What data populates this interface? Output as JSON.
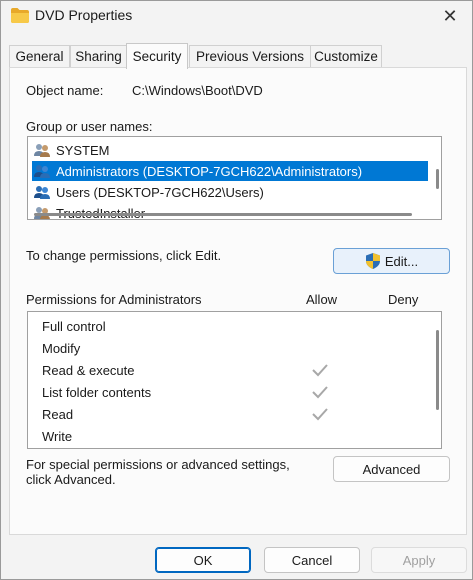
{
  "window": {
    "title": "DVD Properties",
    "close_glyph": "✕",
    "folder_color": "#f5c242"
  },
  "tabs": [
    {
      "label": "General",
      "active": false
    },
    {
      "label": "Sharing",
      "active": false
    },
    {
      "label": "Security",
      "active": true
    },
    {
      "label": "Previous Versions",
      "active": false
    },
    {
      "label": "Customize",
      "active": false
    }
  ],
  "security": {
    "object_name_label": "Object name:",
    "object_name_value": "C:\\Windows\\Boot\\DVD",
    "group_label": "Group or user names:",
    "users": [
      {
        "name": "SYSTEM",
        "selected": false
      },
      {
        "name": "Administrators (DESKTOP-7GCH622\\Administrators)",
        "selected": true
      },
      {
        "name": "Users (DESKTOP-7GCH622\\Users)",
        "selected": false
      },
      {
        "name": "TrustedInstaller",
        "selected": false
      }
    ],
    "change_hint": "To change permissions, click Edit.",
    "edit_button": "Edit...",
    "permissions_label": "Permissions for Administrators",
    "allow_header": "Allow",
    "deny_header": "Deny",
    "permissions": [
      {
        "name": "Full control",
        "allow": false,
        "deny": false
      },
      {
        "name": "Modify",
        "allow": false,
        "deny": false
      },
      {
        "name": "Read & execute",
        "allow": true,
        "deny": false
      },
      {
        "name": "List folder contents",
        "allow": true,
        "deny": false
      },
      {
        "name": "Read",
        "allow": true,
        "deny": false
      },
      {
        "name": "Write",
        "allow": false,
        "deny": false
      }
    ],
    "special_hint_line1": "For special permissions or advanced settings,",
    "special_hint_line2": "click Advanced.",
    "advanced_button": "Advanced"
  },
  "footer": {
    "ok": "OK",
    "cancel": "Cancel",
    "apply": "Apply"
  },
  "colors": {
    "selection": "#0078d4",
    "accent_border": "#0067c0"
  }
}
